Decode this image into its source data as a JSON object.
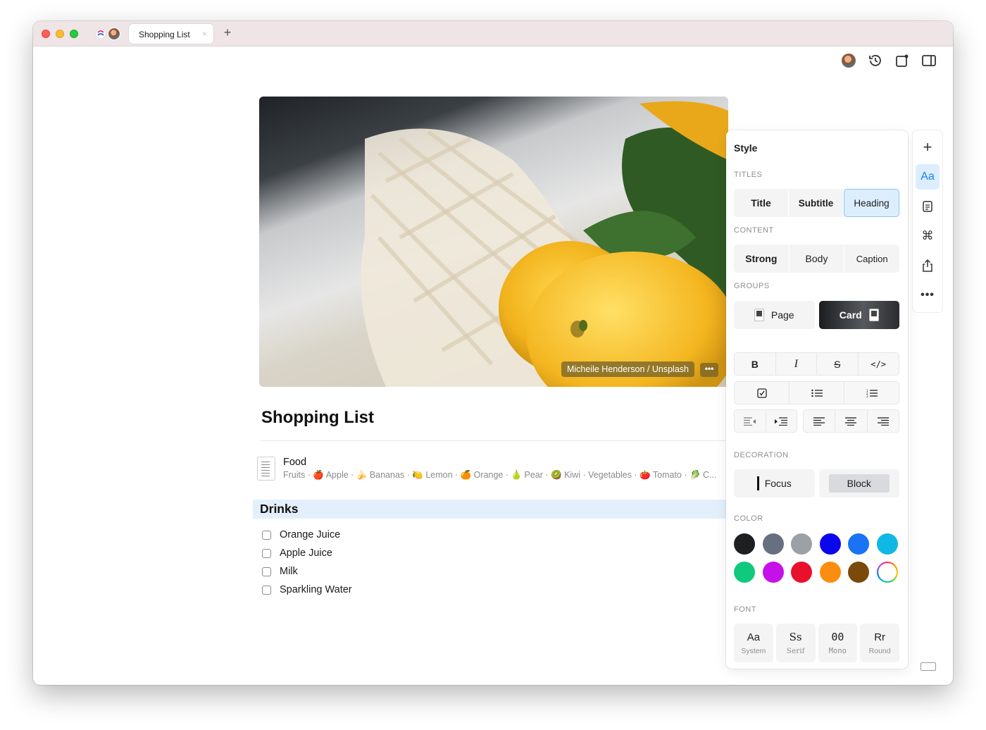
{
  "browser": {
    "tab_title": "Shopping List",
    "tab_close": "×",
    "new_tab": "+"
  },
  "toolbar": {
    "icons": [
      "avatar",
      "history-icon",
      "new-note-icon",
      "sidebar-toggle-icon"
    ]
  },
  "document": {
    "cover_credit": "Micheile Henderson / Unsplash",
    "cover_more": "•••",
    "title": "Shopping List",
    "link_card": {
      "name": "Food",
      "meta": "Fruits · 🍎 Apple · 🍌 Bananas · 🍋 Lemon · 🍊 Orange · 🍐 Pear · 🥝 Kiwi · Vegetables · 🍅 Tomato · 🥬 C..."
    },
    "section_heading": "Drinks",
    "todos": [
      "Orange Juice",
      "Apple Juice",
      "Milk",
      "Sparkling Water"
    ]
  },
  "style_panel": {
    "title": "Style",
    "titles_label": "TITLES",
    "titles": [
      "Title",
      "Subtitle",
      "Heading"
    ],
    "titles_selected": "Heading",
    "content_label": "CONTENT",
    "content": [
      "Strong",
      "Body",
      "Caption"
    ],
    "groups_label": "GROUPS",
    "groups": [
      "Page",
      "Card"
    ],
    "format_row1": [
      "B",
      "I",
      "S",
      "</>"
    ],
    "decoration_label": "DECORATION",
    "decoration": [
      "Focus",
      "Block"
    ],
    "color_label": "COLOR",
    "colors": [
      "#1d1f21",
      "#667080",
      "#9da0a5",
      "#0a06f0",
      "#1a72f5",
      "#10b8e6",
      "#0ec97e",
      "#c510ea",
      "#e8102a",
      "#fd8d10",
      "#7a4a0a",
      "rainbow"
    ],
    "font_label": "FONT",
    "fonts": [
      {
        "glyph": "Aa",
        "name": "System"
      },
      {
        "glyph": "Ss",
        "name": "Serif"
      },
      {
        "glyph": "00",
        "name": "Mono"
      },
      {
        "glyph": "Rr",
        "name": "Round"
      }
    ]
  },
  "rail": {
    "items": [
      "plus-icon",
      "Aa",
      "document-info-icon",
      "command-icon",
      "share-icon",
      "more-icon"
    ],
    "selected": "Aa"
  }
}
